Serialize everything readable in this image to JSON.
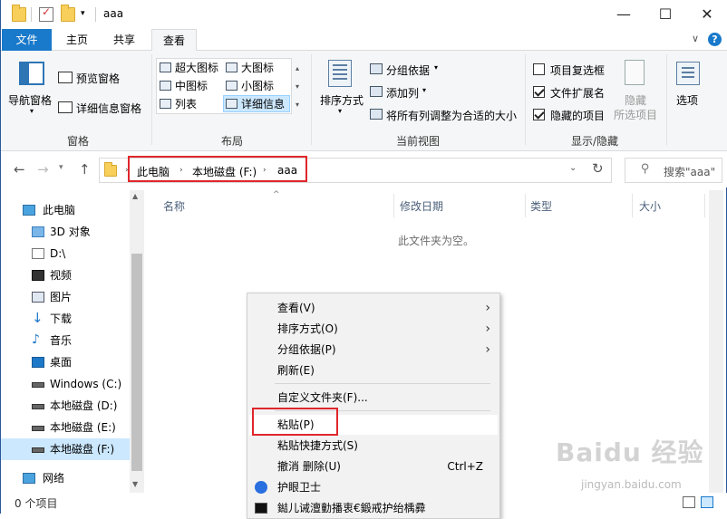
{
  "window": {
    "title": "aaa",
    "controls": {
      "minimize": "—",
      "maximize": "☐",
      "close": "✕"
    }
  },
  "tabs": {
    "file": "文件",
    "home": "主页",
    "share": "共享",
    "view": "查看",
    "expand": "∨",
    "help": "?"
  },
  "ribbon": {
    "panes": {
      "label": "窗格",
      "nav_pane": "导航窗格",
      "preview_pane": "预览窗格",
      "details_pane": "详细信息窗格"
    },
    "layout": {
      "label": "布局",
      "items": [
        "超大图标",
        "大图标",
        "中图标",
        "小图标",
        "列表",
        "详细信息"
      ]
    },
    "current_view": {
      "label": "当前视图",
      "sort_by": "排序方式",
      "group_by": "分组依据",
      "add_column": "添加列",
      "fit_columns": "将所有列调整为合适的大小"
    },
    "show_hide": {
      "label": "显示/隐藏",
      "item_checkboxes": "项目复选框",
      "file_extensions": "文件扩展名",
      "hidden_items": "隐藏的项目",
      "hide": "隐藏",
      "hide_selected": "所选项目",
      "item_checkboxes_checked": false,
      "file_extensions_checked": true,
      "hidden_items_checked": true
    },
    "options": "选项"
  },
  "address": {
    "crumbs": [
      "此电脑",
      "本地磁盘 (F:)",
      "aaa"
    ],
    "search_placeholder": "搜索\"aaa\""
  },
  "nav": {
    "items": [
      {
        "label": "此电脑",
        "icon": "computer-icon"
      },
      {
        "label": "3D 对象",
        "icon": "cube-icon"
      },
      {
        "label": "D:\\",
        "icon": "document-icon"
      },
      {
        "label": "视频",
        "icon": "video-icon"
      },
      {
        "label": "图片",
        "icon": "picture-icon"
      },
      {
        "label": "下载",
        "icon": "download-icon"
      },
      {
        "label": "音乐",
        "icon": "music-icon"
      },
      {
        "label": "桌面",
        "icon": "desktop-icon"
      },
      {
        "label": "Windows (C:)",
        "icon": "drive-icon"
      },
      {
        "label": "本地磁盘 (D:)",
        "icon": "drive-icon"
      },
      {
        "label": "本地磁盘 (E:)",
        "icon": "drive-icon"
      },
      {
        "label": "本地磁盘 (F:)",
        "icon": "drive-icon"
      },
      {
        "label": "网络",
        "icon": "network-icon"
      }
    ]
  },
  "content": {
    "columns": [
      "名称",
      "修改日期",
      "类型",
      "大小"
    ],
    "empty_message": "此文件夹为空。"
  },
  "status": "0 个项目",
  "context_menu": {
    "items": [
      {
        "label": "查看(V)",
        "shortcut": "",
        "submenu": true
      },
      {
        "label": "排序方式(O)",
        "shortcut": "",
        "submenu": true
      },
      {
        "label": "分组依据(P)",
        "shortcut": "",
        "submenu": true
      },
      {
        "label": "刷新(E)",
        "shortcut": "",
        "submenu": false
      },
      {
        "label": "自定义文件夹(F)...",
        "shortcut": "",
        "submenu": false
      },
      {
        "label": "粘贴(P)",
        "shortcut": "",
        "submenu": false
      },
      {
        "label": "粘贴快捷方式(S)",
        "shortcut": "",
        "submenu": false
      },
      {
        "label": "撤消 删除(U)",
        "shortcut": "Ctrl+Z",
        "submenu": false
      },
      {
        "label": "护眼卫士",
        "shortcut": "",
        "submenu": false
      },
      {
        "label": "鐑儿诫澶勭播衷€鍛戒护绐楀彛",
        "shortcut": "",
        "submenu": false
      }
    ]
  },
  "watermark": {
    "main": "Baidu 经验",
    "sub": "jingyan.baidu.com"
  },
  "colors": {
    "accent": "#1979ca",
    "highlight_box": "#e0262b",
    "selection": "#cce8ff"
  }
}
